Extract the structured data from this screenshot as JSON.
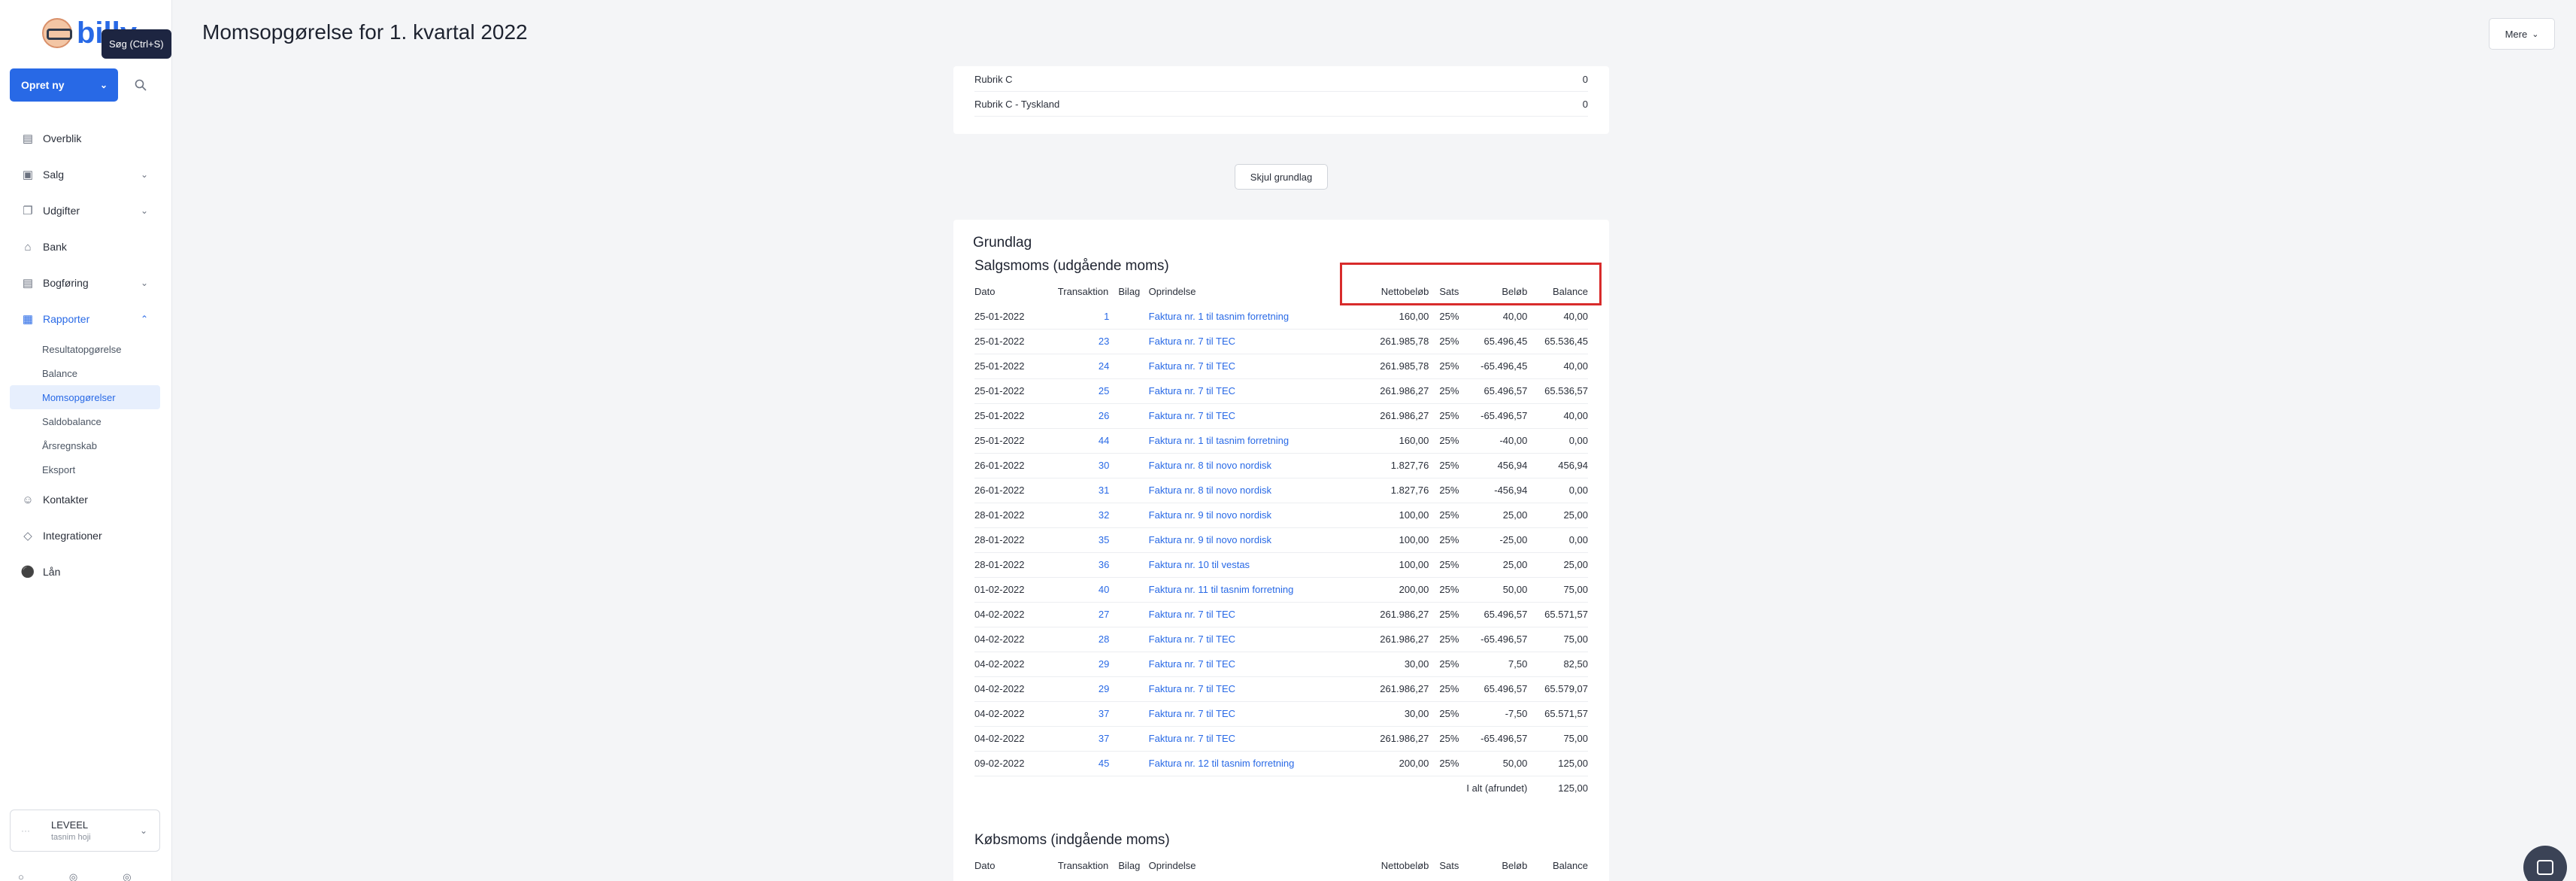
{
  "app": {
    "logo_text": "billy",
    "search_tooltip": "Søg (Ctrl+S)"
  },
  "sidebar": {
    "create_label": "Opret ny",
    "items": [
      {
        "label": "Overblik",
        "icon": "overview-icon"
      },
      {
        "label": "Salg",
        "icon": "sales-icon"
      },
      {
        "label": "Udgifter",
        "icon": "expenses-icon"
      },
      {
        "label": "Bank",
        "icon": "bank-icon"
      },
      {
        "label": "Bogføring",
        "icon": "bookkeeping-icon"
      },
      {
        "label": "Rapporter",
        "icon": "reports-icon"
      },
      {
        "label": "Kontakter",
        "icon": "contacts-icon"
      },
      {
        "label": "Integrationer",
        "icon": "integrations-icon"
      },
      {
        "label": "Lån",
        "icon": "loan-icon"
      }
    ],
    "reports_sub": [
      "Resultatopgørelse",
      "Balance",
      "Momsopgørelser",
      "Saldobalance",
      "Årsregnskab",
      "Eksport"
    ],
    "account": {
      "company": "LEVEEL",
      "user": "tasnim hoji"
    }
  },
  "header": {
    "title": "Momsopgørelse for 1. kvartal 2022",
    "more_label": "Mere"
  },
  "summary_rows": [
    {
      "label": "Rubrik C",
      "value": "0"
    },
    {
      "label": "Rubrik C - Tyskland",
      "value": "0"
    }
  ],
  "toggle_label": "Skjul grundlag",
  "basis": {
    "title": "Grundlag",
    "sales_title": "Salgsmoms (udgående moms)",
    "purchase_title": "Købsmoms (indgående moms)",
    "columns": {
      "dato": "Dato",
      "trans": "Transaktion",
      "bilag": "Bilag",
      "opr": "Oprindelse",
      "net": "Nettobeløb",
      "sats": "Sats",
      "bel": "Beløb",
      "bal": "Balance"
    },
    "rows": [
      {
        "dato": "25-01-2022",
        "trans": "1",
        "opr": "Faktura nr. 1 til tasnim forretning",
        "net": "160,00",
        "sats": "25%",
        "bel": "40,00",
        "bal": "40,00"
      },
      {
        "dato": "25-01-2022",
        "trans": "23",
        "opr": "Faktura nr. 7 til TEC",
        "net": "261.985,78",
        "sats": "25%",
        "bel": "65.496,45",
        "bal": "65.536,45"
      },
      {
        "dato": "25-01-2022",
        "trans": "24",
        "opr": "Faktura nr. 7 til TEC",
        "net": "261.985,78",
        "sats": "25%",
        "bel": "-65.496,45",
        "bal": "40,00"
      },
      {
        "dato": "25-01-2022",
        "trans": "25",
        "opr": "Faktura nr. 7 til TEC",
        "net": "261.986,27",
        "sats": "25%",
        "bel": "65.496,57",
        "bal": "65.536,57"
      },
      {
        "dato": "25-01-2022",
        "trans": "26",
        "opr": "Faktura nr. 7 til TEC",
        "net": "261.986,27",
        "sats": "25%",
        "bel": "-65.496,57",
        "bal": "40,00"
      },
      {
        "dato": "25-01-2022",
        "trans": "44",
        "opr": "Faktura nr. 1 til tasnim forretning",
        "net": "160,00",
        "sats": "25%",
        "bel": "-40,00",
        "bal": "0,00"
      },
      {
        "dato": "26-01-2022",
        "trans": "30",
        "opr": "Faktura nr. 8 til novo nordisk",
        "net": "1.827,76",
        "sats": "25%",
        "bel": "456,94",
        "bal": "456,94"
      },
      {
        "dato": "26-01-2022",
        "trans": "31",
        "opr": "Faktura nr. 8 til novo nordisk",
        "net": "1.827,76",
        "sats": "25%",
        "bel": "-456,94",
        "bal": "0,00"
      },
      {
        "dato": "28-01-2022",
        "trans": "32",
        "opr": "Faktura nr. 9 til novo nordisk",
        "net": "100,00",
        "sats": "25%",
        "bel": "25,00",
        "bal": "25,00"
      },
      {
        "dato": "28-01-2022",
        "trans": "35",
        "opr": "Faktura nr. 9 til novo nordisk",
        "net": "100,00",
        "sats": "25%",
        "bel": "-25,00",
        "bal": "0,00"
      },
      {
        "dato": "28-01-2022",
        "trans": "36",
        "opr": "Faktura nr. 10 til vestas",
        "net": "100,00",
        "sats": "25%",
        "bel": "25,00",
        "bal": "25,00"
      },
      {
        "dato": "01-02-2022",
        "trans": "40",
        "opr": "Faktura nr. 11 til tasnim forretning",
        "net": "200,00",
        "sats": "25%",
        "bel": "50,00",
        "bal": "75,00"
      },
      {
        "dato": "04-02-2022",
        "trans": "27",
        "opr": "Faktura nr. 7 til TEC",
        "net": "261.986,27",
        "sats": "25%",
        "bel": "65.496,57",
        "bal": "65.571,57"
      },
      {
        "dato": "04-02-2022",
        "trans": "28",
        "opr": "Faktura nr. 7 til TEC",
        "net": "261.986,27",
        "sats": "25%",
        "bel": "-65.496,57",
        "bal": "75,00"
      },
      {
        "dato": "04-02-2022",
        "trans": "29",
        "opr": "Faktura nr. 7 til TEC",
        "net": "30,00",
        "sats": "25%",
        "bel": "7,50",
        "bal": "82,50"
      },
      {
        "dato": "04-02-2022",
        "trans": "29",
        "opr": "Faktura nr. 7 til TEC",
        "net": "261.986,27",
        "sats": "25%",
        "bel": "65.496,57",
        "bal": "65.579,07"
      },
      {
        "dato": "04-02-2022",
        "trans": "37",
        "opr": "Faktura nr. 7 til TEC",
        "net": "30,00",
        "sats": "25%",
        "bel": "-7,50",
        "bal": "65.571,57"
      },
      {
        "dato": "04-02-2022",
        "trans": "37",
        "opr": "Faktura nr. 7 til TEC",
        "net": "261.986,27",
        "sats": "25%",
        "bel": "-65.496,57",
        "bal": "75,00"
      },
      {
        "dato": "09-02-2022",
        "trans": "45",
        "opr": "Faktura nr. 12 til tasnim forretning",
        "net": "200,00",
        "sats": "25%",
        "bel": "50,00",
        "bal": "125,00"
      }
    ],
    "total_label": "I alt (afrundet)",
    "total_value": "125,00"
  },
  "colors": {
    "accent": "#2869e6",
    "highlight": "#d82b2b"
  }
}
